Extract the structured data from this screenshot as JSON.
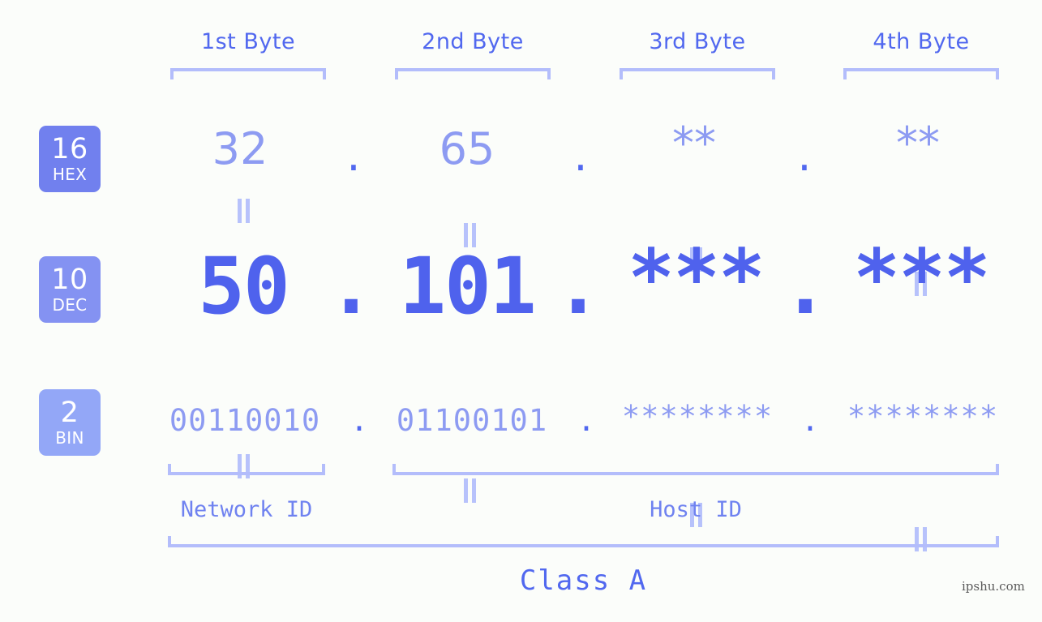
{
  "meta": {
    "background_color": "#fbfdfa",
    "accent_color": "#5168ef",
    "light_accent_color": "#b3bdfb",
    "badge_hex_color": "#7180ee",
    "badge_dec_color": "#8492f2",
    "badge_bin_color": "#93a7f7",
    "watermark": "ipshu.com"
  },
  "byte_headers": [
    {
      "label": "1st Byte"
    },
    {
      "label": "2nd Byte"
    },
    {
      "label": "3rd Byte"
    },
    {
      "label": "4th Byte"
    }
  ],
  "rows": {
    "hex": {
      "badge": {
        "number": "16",
        "name": "HEX"
      },
      "values": [
        "32",
        "65",
        "**",
        "**"
      ],
      "separator": "."
    },
    "dec": {
      "badge": {
        "number": "10",
        "name": "DEC"
      },
      "values": [
        "50",
        "101",
        "***",
        "***"
      ],
      "separator": "."
    },
    "bin": {
      "badge": {
        "number": "2",
        "name": "BIN"
      },
      "values": [
        "00110010",
        "01100101",
        "********",
        "********"
      ],
      "separator": "."
    }
  },
  "equals_marker": "||",
  "sections": [
    {
      "label": "Network ID"
    },
    {
      "label": "Host ID"
    }
  ],
  "class": {
    "label": "Class A"
  }
}
